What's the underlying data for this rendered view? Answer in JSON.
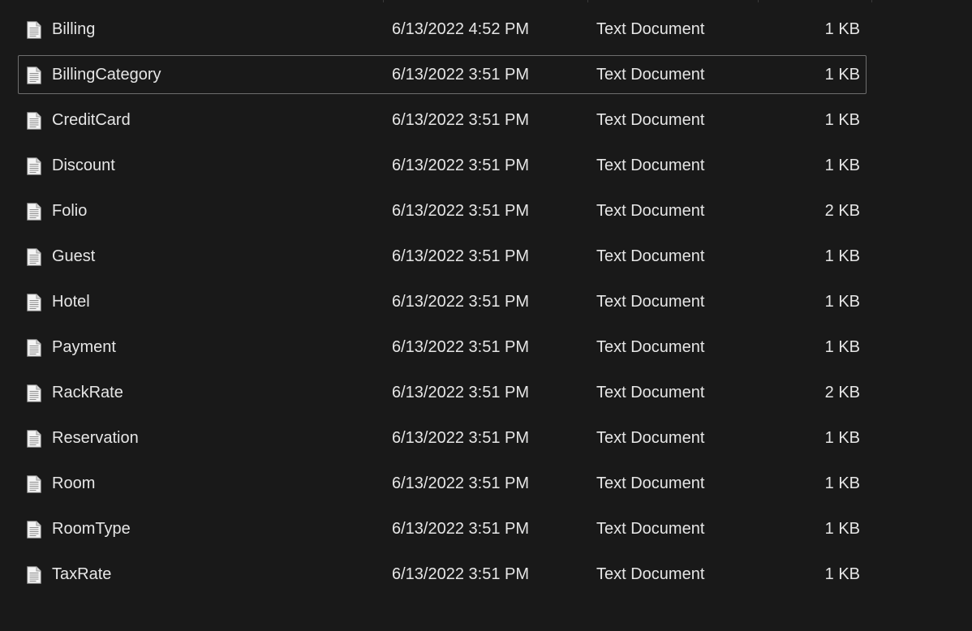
{
  "files": [
    {
      "name": "Billing",
      "date_modified": "6/13/2022 4:52 PM",
      "type": "Text Document",
      "size": "1 KB",
      "icon": "text-file-icon",
      "focused": false
    },
    {
      "name": "BillingCategory",
      "date_modified": "6/13/2022 3:51 PM",
      "type": "Text Document",
      "size": "1 KB",
      "icon": "text-file-icon",
      "focused": true
    },
    {
      "name": "CreditCard",
      "date_modified": "6/13/2022 3:51 PM",
      "type": "Text Document",
      "size": "1 KB",
      "icon": "text-file-icon",
      "focused": false
    },
    {
      "name": "Discount",
      "date_modified": "6/13/2022 3:51 PM",
      "type": "Text Document",
      "size": "1 KB",
      "icon": "text-file-icon",
      "focused": false
    },
    {
      "name": "Folio",
      "date_modified": "6/13/2022 3:51 PM",
      "type": "Text Document",
      "size": "2 KB",
      "icon": "text-file-icon",
      "focused": false
    },
    {
      "name": "Guest",
      "date_modified": "6/13/2022 3:51 PM",
      "type": "Text Document",
      "size": "1 KB",
      "icon": "text-file-icon",
      "focused": false
    },
    {
      "name": "Hotel",
      "date_modified": "6/13/2022 3:51 PM",
      "type": "Text Document",
      "size": "1 KB",
      "icon": "text-file-icon",
      "focused": false
    },
    {
      "name": "Payment",
      "date_modified": "6/13/2022 3:51 PM",
      "type": "Text Document",
      "size": "1 KB",
      "icon": "text-file-icon",
      "focused": false
    },
    {
      "name": "RackRate",
      "date_modified": "6/13/2022 3:51 PM",
      "type": "Text Document",
      "size": "2 KB",
      "icon": "text-file-icon",
      "focused": false
    },
    {
      "name": "Reservation",
      "date_modified": "6/13/2022 3:51 PM",
      "type": "Text Document",
      "size": "1 KB",
      "icon": "text-file-icon",
      "focused": false
    },
    {
      "name": "Room",
      "date_modified": "6/13/2022 3:51 PM",
      "type": "Text Document",
      "size": "1 KB",
      "icon": "text-file-icon",
      "focused": false
    },
    {
      "name": "RoomType",
      "date_modified": "6/13/2022 3:51 PM",
      "type": "Text Document",
      "size": "1 KB",
      "icon": "text-file-icon",
      "focused": false
    },
    {
      "name": "TaxRate",
      "date_modified": "6/13/2022 3:51 PM",
      "type": "Text Document",
      "size": "1 KB",
      "icon": "text-file-icon",
      "focused": false
    }
  ],
  "colors": {
    "background": "#191919",
    "text": "#e6e6e6",
    "focus_border": "#6e6e6e",
    "column_divider": "#3a3a3a"
  }
}
